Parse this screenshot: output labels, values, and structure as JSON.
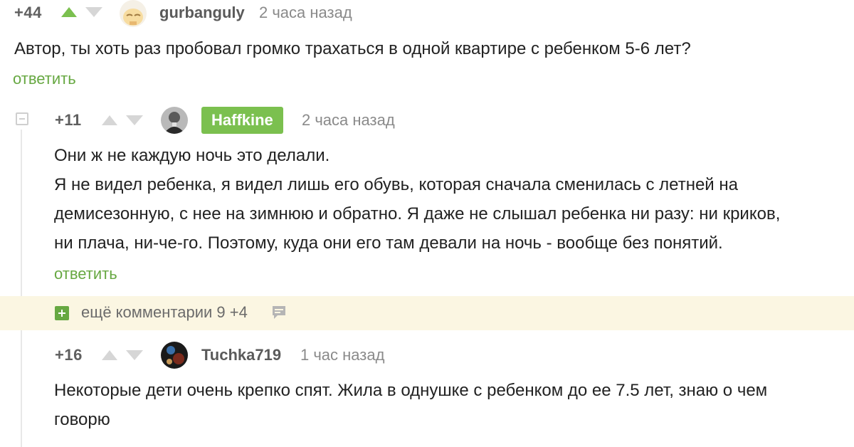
{
  "comments": [
    {
      "score": "+44",
      "username": "gurbanguly",
      "time": "2 часа назад",
      "text": [
        "Автор, ты хоть раз пробовал громко трахаться в одной квартире с ребенком 5-6 лет?"
      ],
      "reply_label": "ответить",
      "avatar_icon": "sleepy-cartoon-avatar-icon"
    },
    {
      "score": "+11",
      "username": "Haffkine",
      "time": "2 часа назад",
      "text": [
        "Они ж не каждую ночь это делали.",
        "Я не видел ребенка, я видел лишь его обувь, которая сначала сменилась с летней на",
        "демисезонную, с нее на зимнюю и обратно. Я даже не слышал ребенка ни разу: ни криков,",
        "ни плача, ни-че-го. Поэтому, куда они его там девали на ночь - вообще без понятий."
      ],
      "reply_label": "ответить",
      "avatar_icon": "portrait-photo-avatar-icon",
      "badge_color": "#7bc04f"
    },
    {
      "score": "+16",
      "username": "Tuchka719",
      "time": "1 час назад",
      "text": [
        "Некоторые дети очень крепко спят. Жила в однушке с ребенком до ее 7.5 лет, знаю о чем",
        "говорю"
      ],
      "avatar_icon": "dark-photo-avatar-icon"
    }
  ],
  "more_comments": {
    "label": "ещё комментарии 9 +4",
    "icon": "comment-bubble-icon"
  },
  "colors": {
    "accent_green": "#67a842",
    "more_bar_bg": "#fbf6e2"
  }
}
